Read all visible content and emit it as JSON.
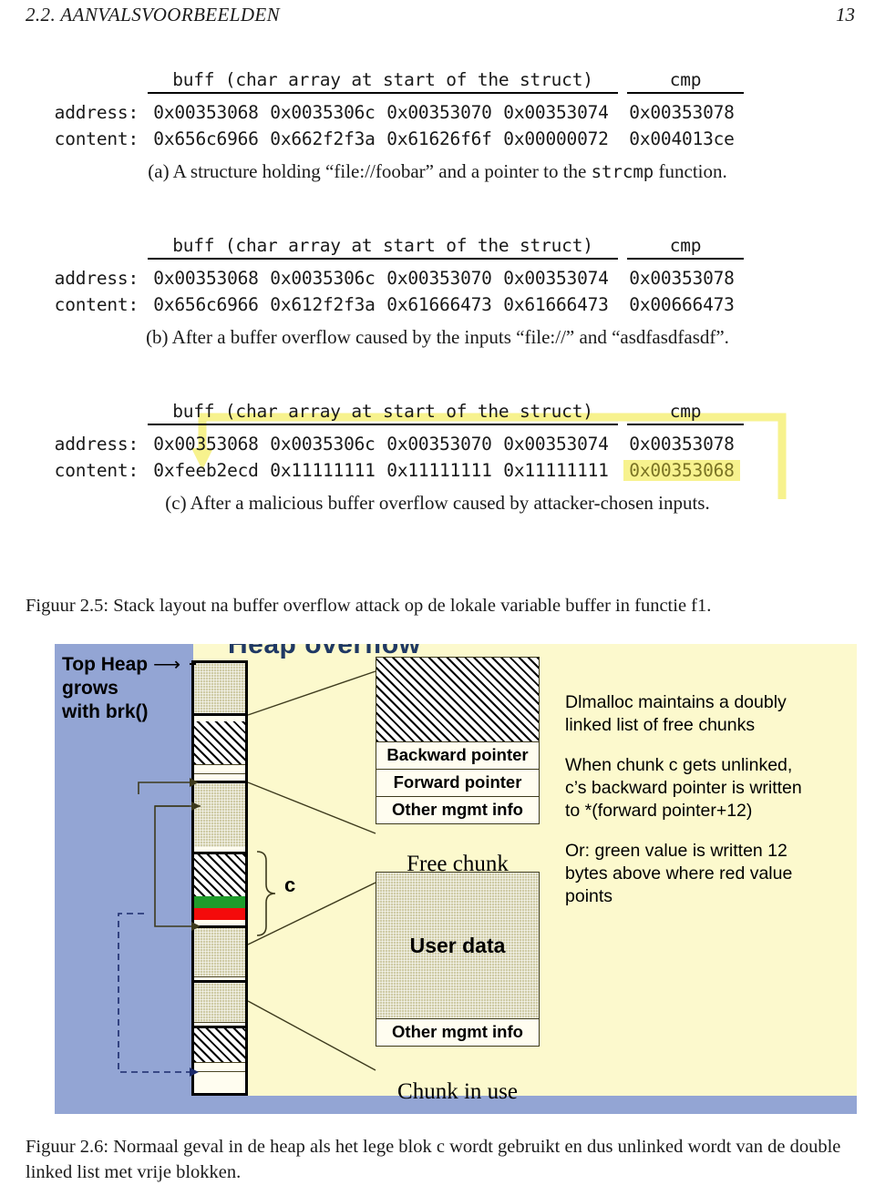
{
  "header": {
    "section_title": "2.2.  AANVALSVOORBEELDEN",
    "page_number": "13"
  },
  "figure_2_5": {
    "caption": "Figuur 2.5: Stack layout na buffer overflow attack op de lokale variable buffer in functie f1.",
    "column_headers": {
      "buff": "buff (char array at start of the struct)",
      "cmp": "cmp"
    },
    "row_labels": {
      "address": "address:",
      "content": "content:"
    },
    "panels": [
      {
        "id": "a",
        "subcaption_pre": "(a) A structure holding “file://foobar” and a pointer to the ",
        "subcaption_mono": "strcmp",
        "subcaption_post": " function.",
        "addresses": [
          "0x00353068",
          "0x0035306c",
          "0x00353070",
          "0x00353074"
        ],
        "cmp_address": "0x00353078",
        "contents": [
          "0x656c6966",
          "0x662f2f3a",
          "0x61626f6f",
          "0x00000072"
        ],
        "cmp_content": "0x004013ce",
        "highlight": false
      },
      {
        "id": "b",
        "subcaption_pre": "(b) After a buffer overflow caused by the inputs “file://” and “asdfasdfasdf”.",
        "subcaption_mono": "",
        "subcaption_post": "",
        "addresses": [
          "0x00353068",
          "0x0035306c",
          "0x00353070",
          "0x00353074"
        ],
        "cmp_address": "0x00353078",
        "contents": [
          "0x656c6966",
          "0x612f2f3a",
          "0x61666473",
          "0x61666473"
        ],
        "cmp_content": "0x00666473",
        "highlight": false
      },
      {
        "id": "c",
        "subcaption_pre": "(c) After a malicious buffer overflow caused by attacker-chosen inputs.",
        "subcaption_mono": "",
        "subcaption_post": "",
        "addresses": [
          "0x00353068",
          "0x0035306c",
          "0x00353070",
          "0x00353074"
        ],
        "cmp_address": "0x00353078",
        "contents": [
          "0xfeeb2ecd",
          "0x11111111",
          "0x11111111",
          "0x11111111"
        ],
        "cmp_content": "0x00353068",
        "highlight": true
      }
    ]
  },
  "figure_2_6": {
    "caption": "Figuur 2.6: Normaal geval in de heap als het lege blok c wordt gebruikt en dus unlinked wordt van de double linked list met vrije blokken.",
    "slide": {
      "heap_label": "Top Heap",
      "heap_label_line2": "grows",
      "heap_label_line3": "with brk()",
      "chunk_letter": "c",
      "free_chunk": {
        "fields": [
          "Backward pointer",
          "Forward pointer",
          "Other mgmt info"
        ],
        "caption": "Free chunk"
      },
      "inuse_chunk": {
        "user_data": "User data",
        "other_mgmt": "Other mgmt info",
        "caption": "Chunk in use"
      },
      "explanation": [
        "Dlmalloc maintains a doubly linked list of free chunks",
        "When chunk c gets unlinked, c’s backward pointer is written to *(forward pointer+12)",
        "Or: green value is written 12 bytes above where red value points"
      ],
      "colors": {
        "band": "#93a5d4",
        "background": "#fcf9cd",
        "green_block": "#1f9c2b",
        "red_block": "#f40b0b",
        "highlight": "#f7f28e"
      }
    }
  }
}
